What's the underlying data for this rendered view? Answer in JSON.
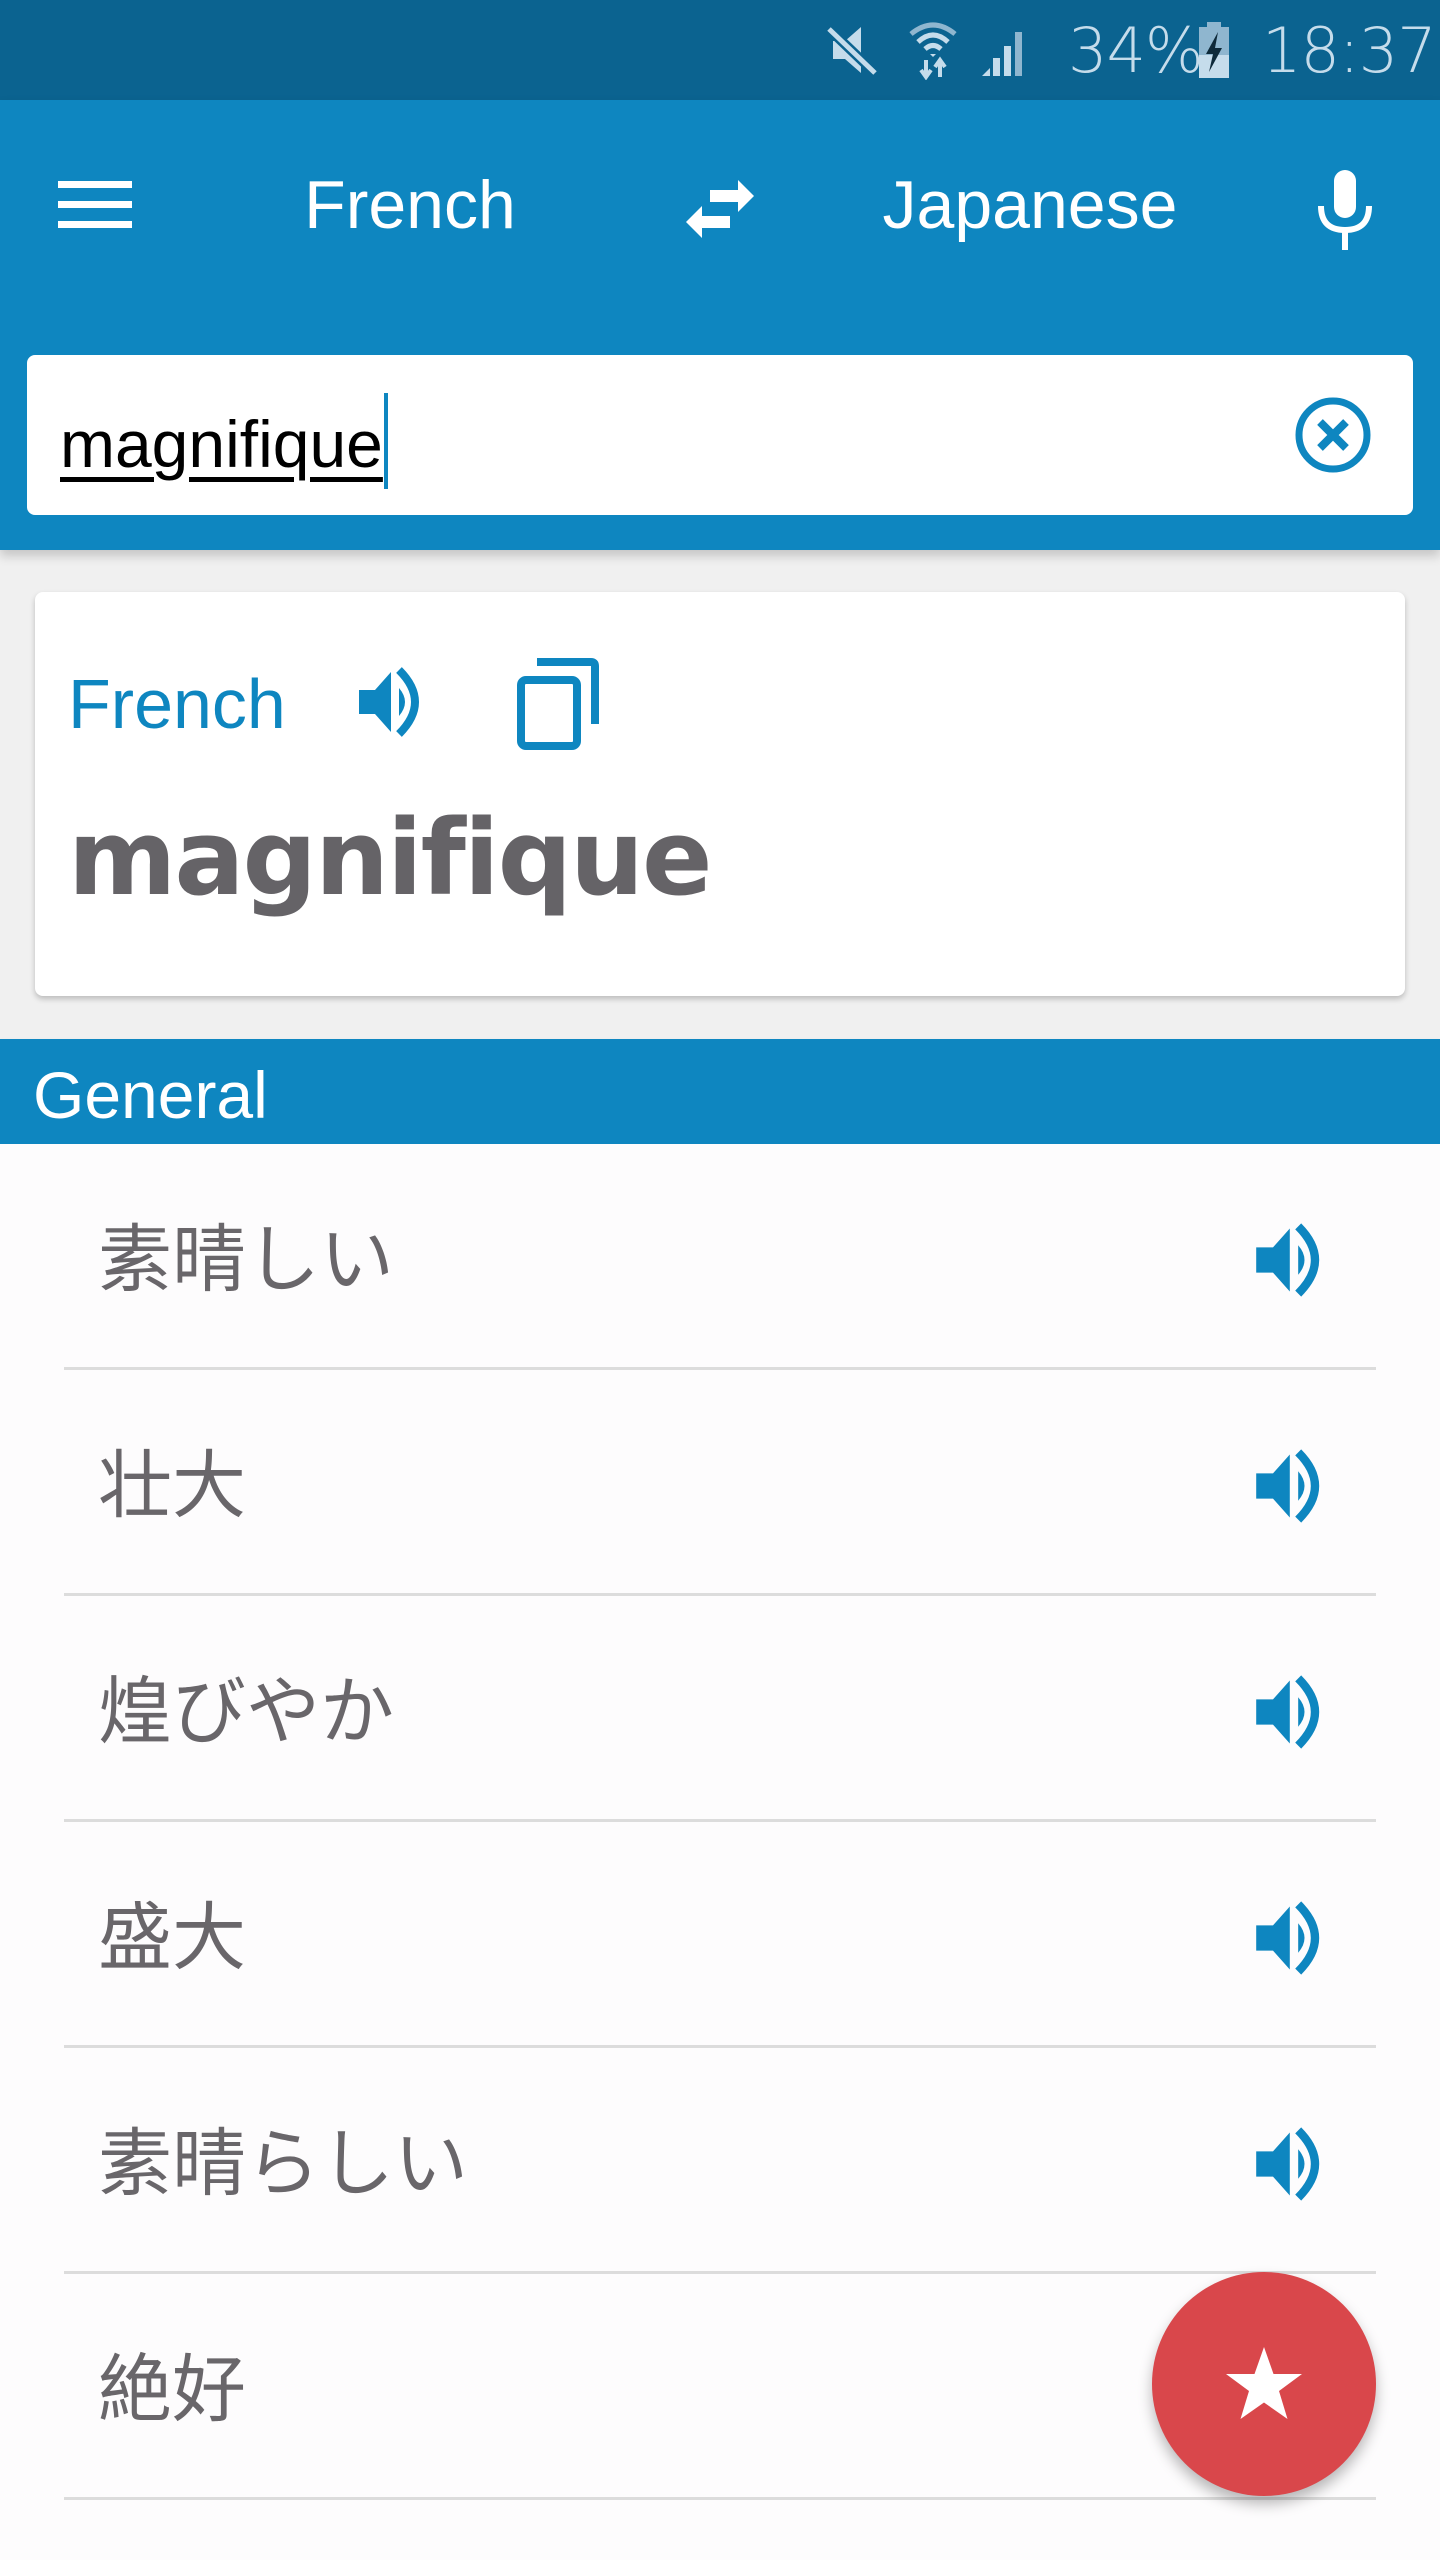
{
  "status_bar": {
    "icons": [
      "mute-icon",
      "wifi-icon",
      "signal-icon",
      "battery-charging-icon"
    ],
    "battery": "34%",
    "time": "18:37"
  },
  "app_bar": {
    "menu_icon": "hamburger-menu-icon",
    "source_language": "French",
    "swap_icon": "swap-arrows-icon",
    "target_language": "Japanese",
    "mic_icon": "microphone-icon"
  },
  "search": {
    "value": "magnifique",
    "placeholder": "",
    "clear_icon": "clear-circle-icon"
  },
  "result_card": {
    "language": "French",
    "speak_icon": "speaker-icon",
    "copy_icon": "copy-icon",
    "word": "magnifique"
  },
  "section": {
    "title": "General"
  },
  "translations": [
    {
      "text": "素晴しい",
      "icon": "speaker-icon",
      "has_speaker": true
    },
    {
      "text": "壮大",
      "icon": "speaker-icon",
      "has_speaker": true
    },
    {
      "text": "煌びやか",
      "icon": "speaker-icon",
      "has_speaker": true
    },
    {
      "text": "盛大",
      "icon": "speaker-icon",
      "has_speaker": true
    },
    {
      "text": "素晴らしい",
      "icon": "speaker-icon",
      "has_speaker": true
    },
    {
      "text": "絶好",
      "icon": "speaker-icon",
      "has_speaker": false
    }
  ],
  "fab": {
    "icon": "star-icon"
  },
  "colors": {
    "status_bar": "#0b6390",
    "primary": "#0e86c0",
    "accent": "#d9474b",
    "text_gray": "#69666a",
    "word_gray": "#656367"
  }
}
